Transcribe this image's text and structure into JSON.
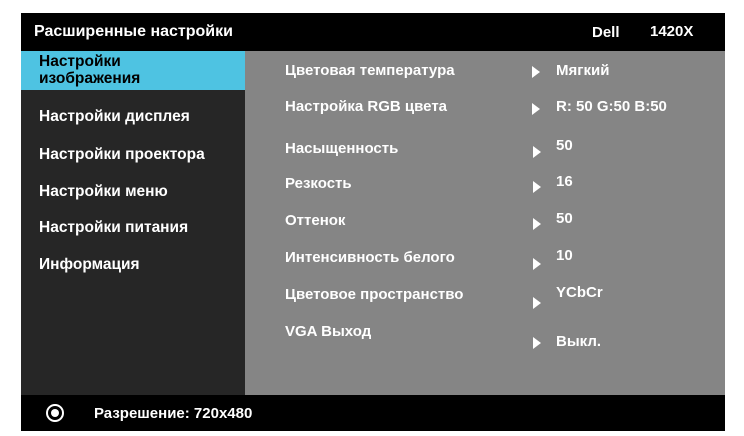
{
  "header": {
    "title": "Расширенные настройки",
    "brand": "Dell",
    "model": "1420X"
  },
  "sidebar": {
    "items": [
      {
        "label_line1": "Настройки",
        "label_line2": "изображения",
        "active": true
      },
      {
        "label": "Настройки дисплея",
        "active": false
      },
      {
        "label": "Настройки проектора",
        "active": false
      },
      {
        "label": "Настройки меню",
        "active": false
      },
      {
        "label": "Настройки питания",
        "active": false
      },
      {
        "label": "Информация",
        "active": false
      }
    ]
  },
  "settings": [
    {
      "label": "Цветовая температура",
      "value": "Мягкий"
    },
    {
      "label": "Настройка RGB цвета",
      "value": "R: 50 G:50 B:50"
    },
    {
      "label": "Насыщенность",
      "value": "50"
    },
    {
      "label": "Резкость",
      "value": "16"
    },
    {
      "label": "Оттенок",
      "value": "50"
    },
    {
      "label": "Интенсивность белого",
      "value": "10"
    },
    {
      "label": "Цветовое пространство",
      "value": "YCbCr"
    },
    {
      "label": "VGA Выход",
      "value": "Выкл."
    }
  ],
  "status": {
    "resolution": "Разрешение: 720x480"
  },
  "colors": {
    "accent": "#4ec3e2",
    "sidebar_bg": "#262626",
    "content_bg": "#858585",
    "bar_bg": "#000000"
  },
  "icons": {
    "status": "disc-icon",
    "row_arrow": "triangle-right-icon"
  }
}
